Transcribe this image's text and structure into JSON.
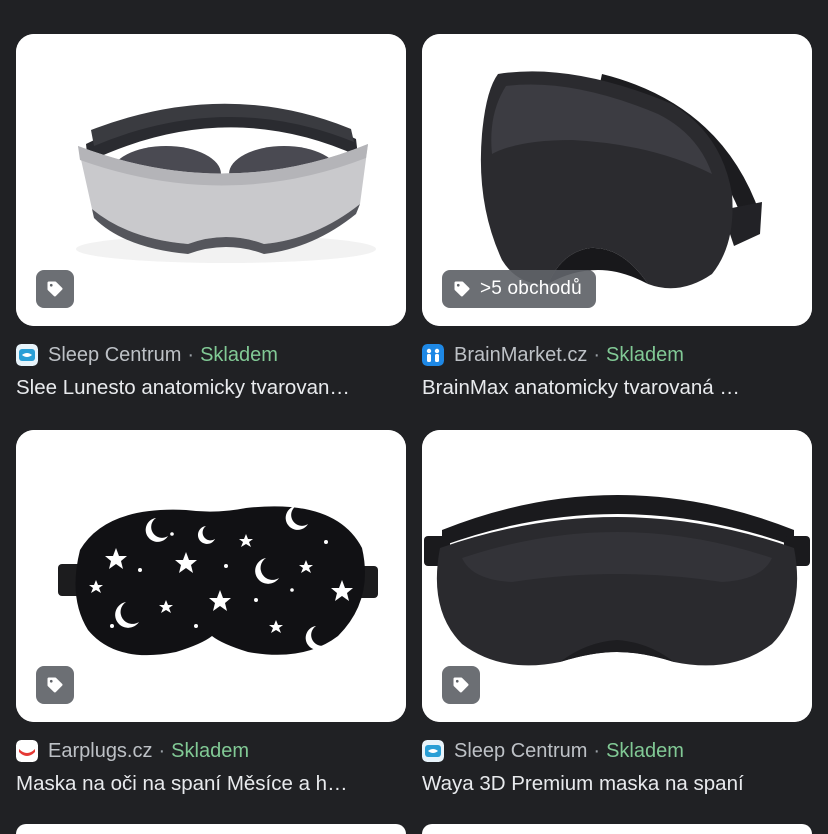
{
  "results": [
    {
      "source": "Sleep Centrum",
      "separator": "·",
      "availability": "Skladem",
      "title": "Slee Lunesto anatomicky tvarovan…",
      "badge_text": "",
      "badge_icon": "price-tag-icon",
      "favicon": "sleep-centrum-favicon"
    },
    {
      "source": "BrainMarket.cz",
      "separator": "·",
      "availability": "Skladem",
      "title": "BrainMax anatomicky tvarovaná …",
      "badge_text": ">5 obchodů",
      "badge_icon": "price-tag-icon",
      "favicon": "brainmarket-favicon"
    },
    {
      "source": "Earplugs.cz",
      "separator": "·",
      "availability": "Skladem",
      "title": "Maska na oči na spaní Měsíce a h…",
      "badge_text": "",
      "badge_icon": "price-tag-icon",
      "favicon": "earplugs-favicon"
    },
    {
      "source": "Sleep Centrum",
      "separator": "·",
      "availability": "Skladem",
      "title": "Waya 3D Premium maska na spaní",
      "badge_text": "",
      "badge_icon": "price-tag-icon",
      "favicon": "sleep-centrum-favicon"
    }
  ],
  "colors": {
    "background": "#202124",
    "availability": "#81c995",
    "source_text": "#bdc1c6",
    "title_text": "#e8eaed"
  }
}
